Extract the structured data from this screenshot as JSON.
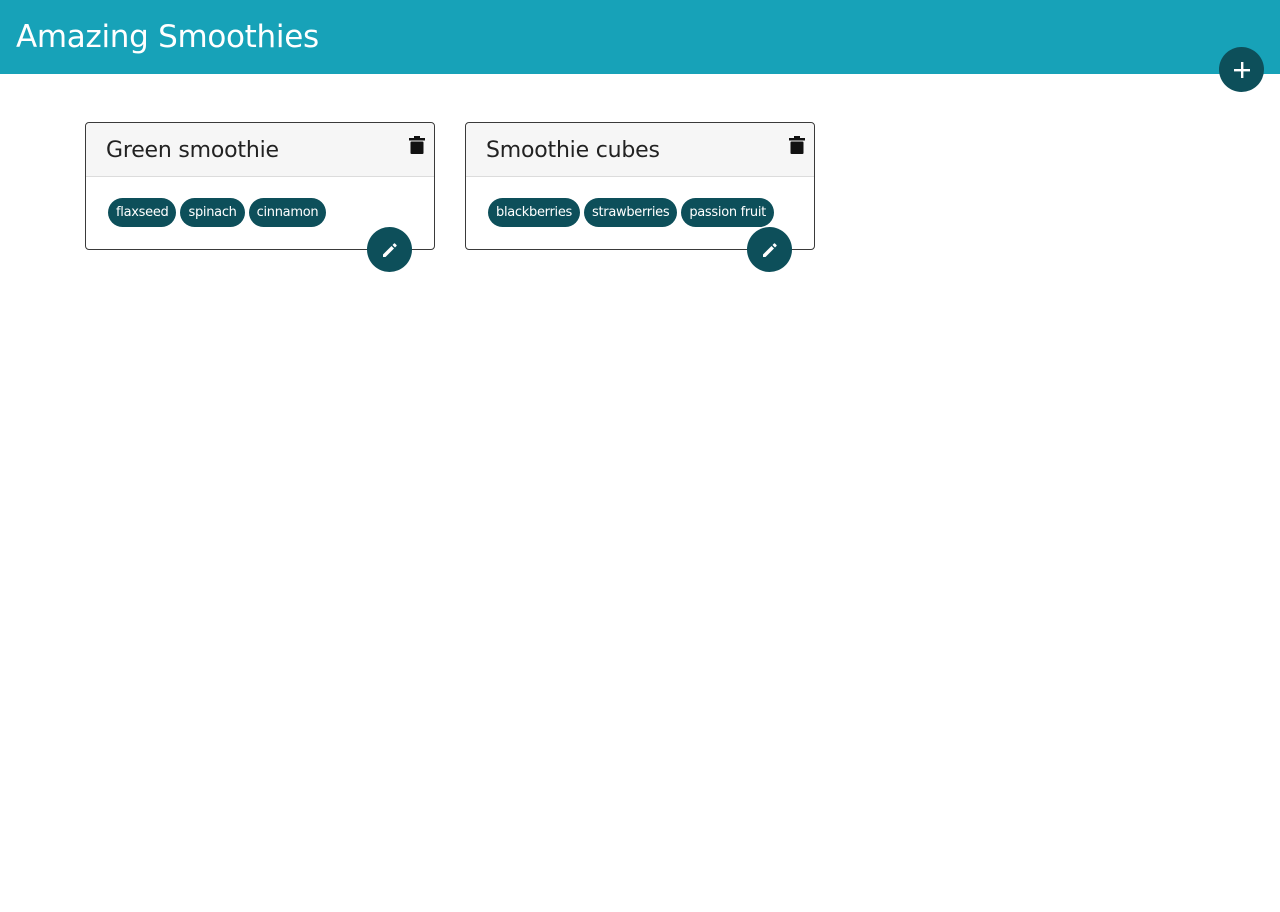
{
  "app": {
    "title": "Amazing Smoothies",
    "add_icon": "plus-icon",
    "colors": {
      "header": "#17a2b8",
      "accent": "#0d4f5a"
    }
  },
  "cards": [
    {
      "title": "Green smoothie",
      "tags": [
        "flaxseed",
        "spinach",
        "cinnamon"
      ],
      "delete_icon": "trash-icon",
      "edit_icon": "pencil-icon"
    },
    {
      "title": "Smoothie cubes",
      "tags": [
        "blackberries",
        "strawberries",
        "passion fruit"
      ],
      "delete_icon": "trash-icon",
      "edit_icon": "pencil-icon"
    }
  ]
}
